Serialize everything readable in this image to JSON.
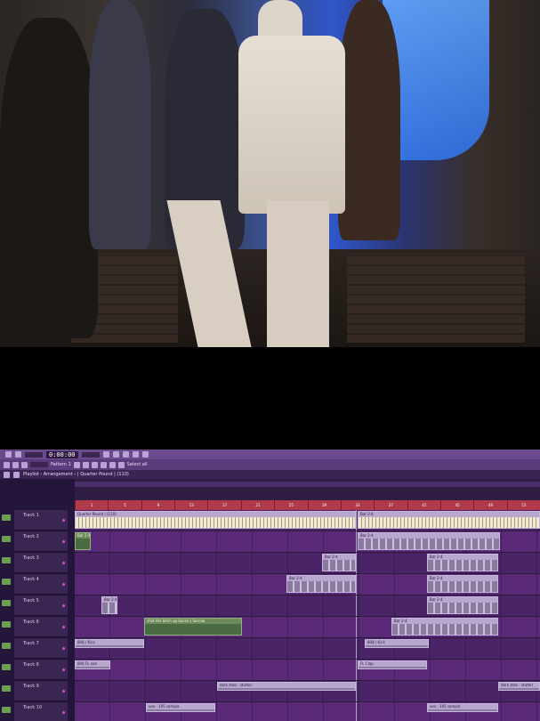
{
  "video": {},
  "toolbar": {
    "time": "0:00:00",
    "pattern": "Pattern 1",
    "hint": "Select all"
  },
  "playlist": {
    "title": "Playlist - Arrangement › | Quarter Pound | (110)"
  },
  "ruler_ticks": [
    "1",
    "5",
    "9",
    "13",
    "17",
    "21",
    "25",
    "29",
    "33",
    "37",
    "41",
    "45",
    "49",
    "53"
  ],
  "tracks": [
    {
      "label": "Track 1"
    },
    {
      "label": "Track 2"
    },
    {
      "label": "Track 3"
    },
    {
      "label": "Track 4"
    },
    {
      "label": "Track 5"
    },
    {
      "label": "Track 6"
    },
    {
      "label": "Track 7"
    },
    {
      "label": "Track 8"
    },
    {
      "label": "Track 9"
    },
    {
      "label": "Track 10"
    }
  ],
  "clips": {
    "quarter_pound": "Quarter Pound | (110)",
    "bar": "Bar 2-4",
    "shot_sample": "shot the bitch up bacon | Sorrow",
    "rc_808": "808 / Kick",
    "fl_808": "808 FL sub",
    "clap": "FL Clap",
    "dark_stab": "dark stab - stutter",
    "vox": "vox - 105 sampla"
  },
  "colors": {
    "toolbar": "#6b4a8f",
    "lane": "#4a2466",
    "ruler": "#b03a4c",
    "led": "#6aa050"
  }
}
